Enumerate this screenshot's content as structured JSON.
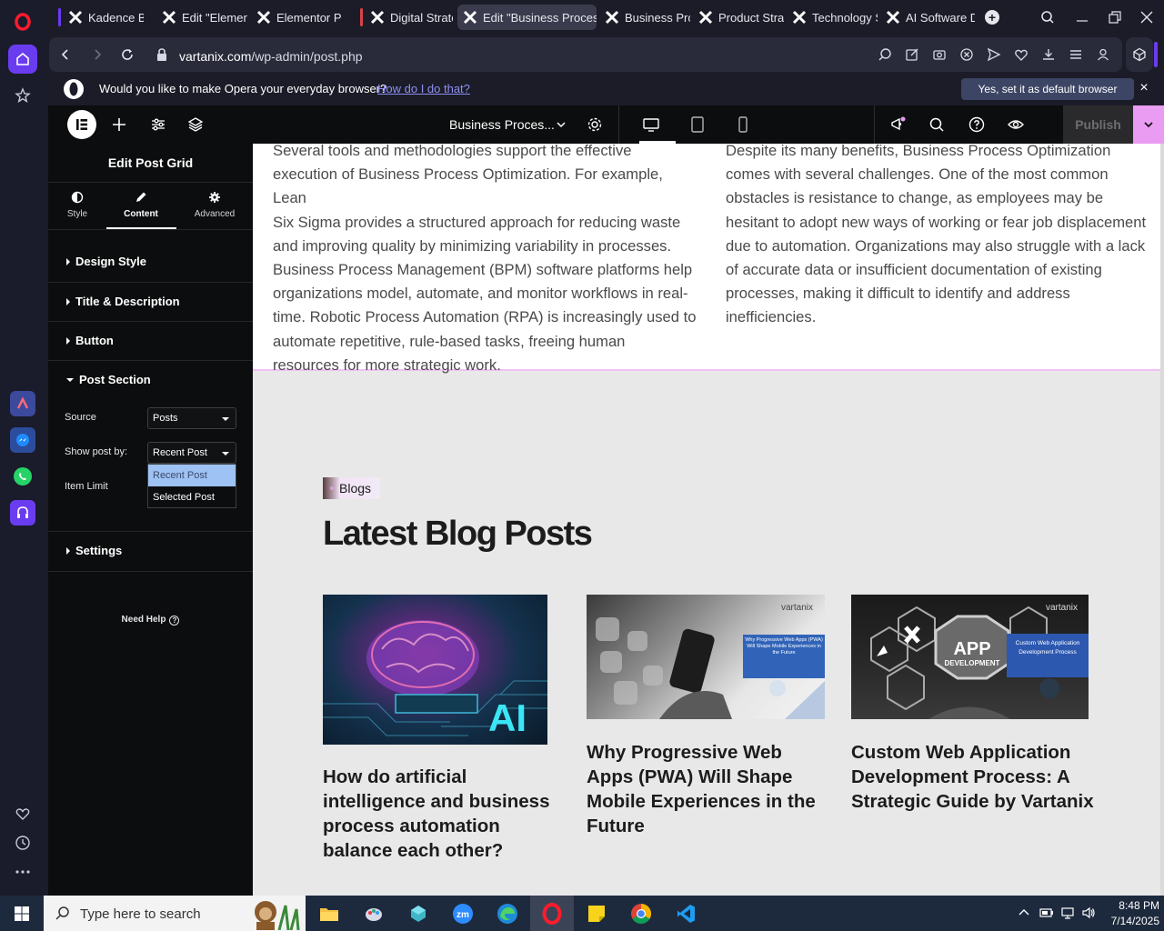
{
  "browser": {
    "tabs": [
      {
        "title": "Kadence Blocks",
        "active": false,
        "marker": "#6a3cf0"
      },
      {
        "title": "Edit \"Elementor",
        "active": false
      },
      {
        "title": "Elementor Page",
        "active": false
      },
      {
        "title": "Digital Strategy",
        "active": false,
        "marker": "#d9424b"
      },
      {
        "title": "Edit \"Business Process Optimization\"",
        "active": true
      },
      {
        "title": "Business Process",
        "active": false
      },
      {
        "title": "Product Strategy",
        "active": false
      },
      {
        "title": "Technology Strategy",
        "active": false
      },
      {
        "title": "AI Software Development",
        "active": false
      }
    ],
    "url_host": "vartanix.com",
    "url_path": "/wp-admin/post.php",
    "default_prompt": {
      "question": "Would you like to make Opera your everyday browser?",
      "link": "How do I do that?",
      "accept": "Yes, set it as default browser",
      "close": "×"
    }
  },
  "editor": {
    "document_title": "Business Proces...",
    "publish_label": "Publish",
    "panel": {
      "title": "Edit Post Grid",
      "tabs": [
        "Style",
        "Content",
        "Advanced"
      ],
      "active_tab": "Content",
      "sections": {
        "design_style": "Design Style",
        "title_description": "Title & Description",
        "button": "Button",
        "post_section": "Post Section",
        "settings": "Settings"
      },
      "fields": {
        "source_label": "Source",
        "source_value": "Posts",
        "show_by_label": "Show post by:",
        "show_by_value": "Recent Post",
        "item_limit_label": "Item Limit"
      },
      "dropdown_options": [
        "Recent Post",
        "Selected Post"
      ],
      "need_help": "Need Help"
    }
  },
  "canvas": {
    "left_paragraph": [
      "Several tools and methodologies support the effective",
      "execution of Business Process Optimization. For example, Lean",
      "Six Sigma provides a structured approach for reducing waste",
      "and improving quality by minimizing variability in processes.",
      "Business Process Management (BPM) software platforms help",
      "organizations model, automate, and monitor workflows in real-",
      "time. Robotic Process Automation (RPA) is increasingly used to",
      "automate repetitive, rule-based tasks, freeing human",
      "resources for more strategic work."
    ],
    "right_paragraph": [
      "Despite its many benefits, Business Process Optimization",
      "comes with several challenges. One of the most common",
      "obstacles is resistance to change, as employees may be",
      "hesitant to adopt new ways of working or fear job displacement",
      "due to automation. Organizations may also struggle with a lack",
      "of accurate data or insufficient documentation of existing",
      "processes, making it difficult to identify and address",
      "inefficiencies."
    ],
    "badge": "Blogs",
    "heading": "Latest Blog Posts",
    "posts": [
      {
        "title": "How do artificial intelligence and business process automation balance each other?",
        "image_text": "AI"
      },
      {
        "title": "Why Progressive Web Apps (PWA) Will Shape Mobile Experiences in the Future",
        "image_brand": "vartanix",
        "image_caption": "Why Progressive Web Apps (PWA) Will Shape Mobile Experiences in the Future"
      },
      {
        "title": "Custom Web Application Development Process: A Strategic Guide by Vartanix",
        "image_brand": "vartanix",
        "image_main": "APP",
        "image_sub": "DEVELOPMENT",
        "image_caption": "Custom Web Application Development Process"
      }
    ]
  },
  "taskbar": {
    "search_placeholder": "Type here to search",
    "time": "8:48 PM",
    "date": "7/14/2025"
  },
  "colors": {
    "elementor_accent": "#e99cf2",
    "opera_red": "#ff1b2d"
  }
}
